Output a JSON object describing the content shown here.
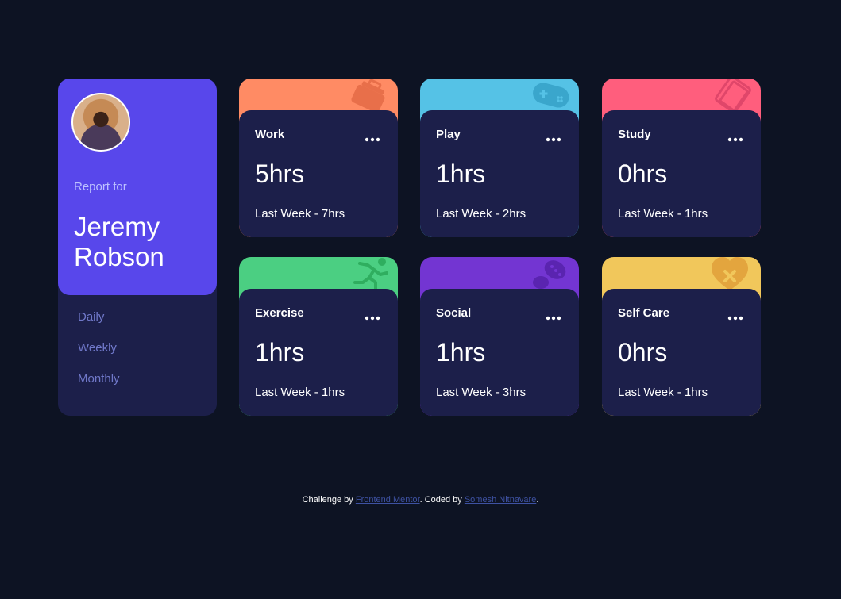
{
  "profile": {
    "report_for": "Report for",
    "name": "Jeremy Robson",
    "periods": [
      "Daily",
      "Weekly",
      "Monthly"
    ]
  },
  "activities": [
    {
      "title": "Work",
      "current": "5hrs",
      "previous": "Last Week - 7hrs",
      "color": "#ff8b64",
      "icon": "briefcase-icon"
    },
    {
      "title": "Play",
      "current": "1hrs",
      "previous": "Last Week - 2hrs",
      "color": "#55c2e6",
      "icon": "gamepad-icon"
    },
    {
      "title": "Study",
      "current": "0hrs",
      "previous": "Last Week - 1hrs",
      "color": "#ff5e7d",
      "icon": "books-icon"
    },
    {
      "title": "Exercise",
      "current": "1hrs",
      "previous": "Last Week - 1hrs",
      "color": "#4bcf82",
      "icon": "runner-icon"
    },
    {
      "title": "Social",
      "current": "1hrs",
      "previous": "Last Week - 3hrs",
      "color": "#7335d2",
      "icon": "chat-icon"
    },
    {
      "title": "Self Care",
      "current": "0hrs",
      "previous": "Last Week - 1hrs",
      "color": "#f1c75b",
      "icon": "heart-icon"
    }
  ],
  "footer": {
    "prefix": "Challenge by ",
    "link1": "Frontend Mentor",
    "middle": ". Coded by ",
    "link2": "Somesh Nitnavare",
    "suffix": "."
  }
}
